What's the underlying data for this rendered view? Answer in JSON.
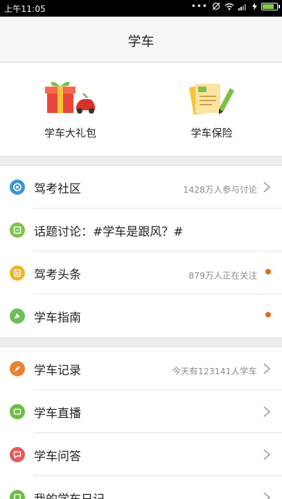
{
  "status_bar": {
    "time": "上午11:05",
    "battery_level": 0.85
  },
  "header": {
    "title": "学车"
  },
  "promo": [
    {
      "label": "学车大礼包",
      "icon": "gift-car-icon"
    },
    {
      "label": "学车保险",
      "icon": "insurance-docs-icon"
    }
  ],
  "group1": [
    {
      "label": "驾考社区",
      "value": "1428万人参与讨论",
      "icon": "community-icon",
      "icon_color": "#3f94d6",
      "accessory": "chevron"
    },
    {
      "label": "话题讨论：#学车是跟风？#",
      "value": "",
      "icon": "topic-icon",
      "icon_color": "#7cc24a",
      "accessory": "none"
    },
    {
      "label": "驾考头条",
      "value": "879万人正在关注",
      "icon": "headline-icon",
      "icon_color": "#f2b326",
      "accessory": "dot"
    },
    {
      "label": "学车指南",
      "value": "",
      "icon": "guide-icon",
      "icon_color": "#6cc05a",
      "accessory": "dot"
    }
  ],
  "group2": [
    {
      "label": "学车记录",
      "value": "今天有123141人学车",
      "icon": "record-icon",
      "icon_color": "#ef7f2e",
      "accessory": "chevron"
    },
    {
      "label": "学车直播",
      "value": "",
      "icon": "live-icon",
      "icon_color": "#6cbd43",
      "accessory": "chevron"
    },
    {
      "label": "学车问答",
      "value": "",
      "icon": "qa-icon",
      "icon_color": "#e65a5a",
      "accessory": "chevron"
    },
    {
      "label": "我的学车日记",
      "value": "",
      "icon": "diary-icon",
      "icon_color": "#6cbd43",
      "accessory": "chevron"
    }
  ],
  "colors": {
    "badge_dot": "#e06a1b",
    "accent_gold": "#f2b326"
  }
}
